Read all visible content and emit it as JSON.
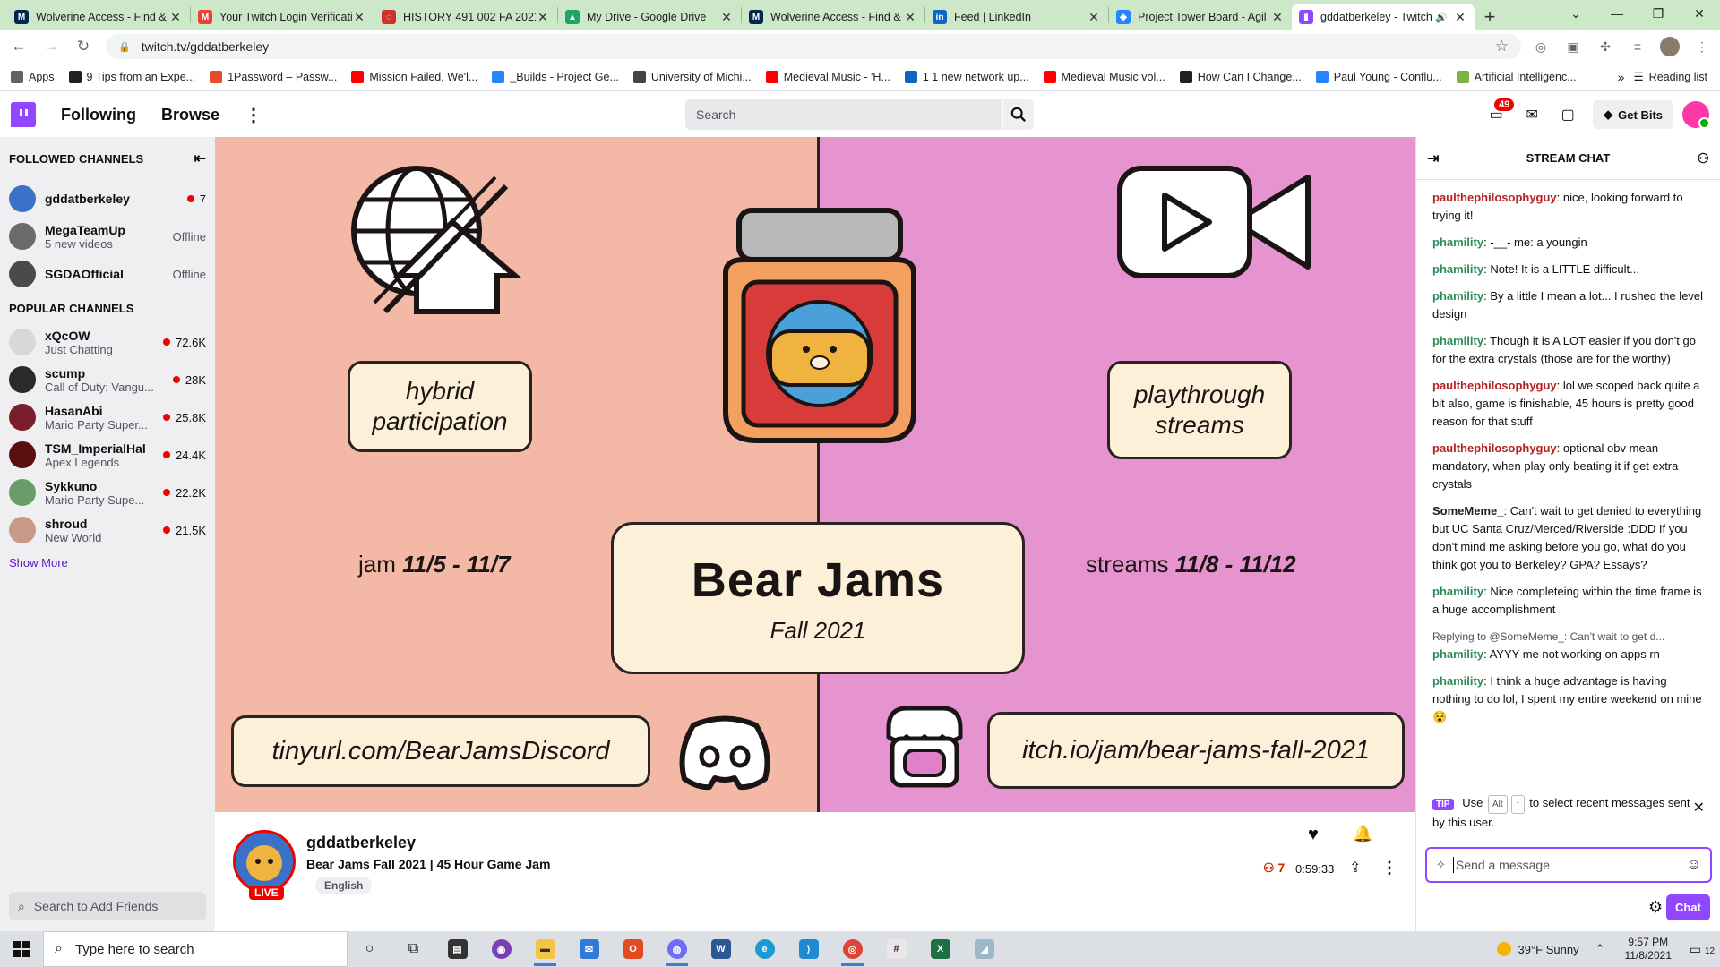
{
  "browser": {
    "tabs": [
      {
        "label": "Wolverine Access - Find &",
        "fav_color": "#00274c",
        "fav_glyph": "M"
      },
      {
        "label": "Your Twitch Login Verificati",
        "fav_color": "#ea4335",
        "fav_glyph": "M"
      },
      {
        "label": "HISTORY 491 002 FA 2021",
        "fav_color": "#d0312d",
        "fav_glyph": "◌"
      },
      {
        "label": "My Drive - Google Drive",
        "fav_color": "#1fa463",
        "fav_glyph": "▲"
      },
      {
        "label": "Wolverine Access - Find &",
        "fav_color": "#00274c",
        "fav_glyph": "M"
      },
      {
        "label": "Feed | LinkedIn",
        "fav_color": "#0a66c2",
        "fav_glyph": "in"
      },
      {
        "label": "Project Tower Board - Agil",
        "fav_color": "#2684ff",
        "fav_glyph": "◆"
      },
      {
        "label": "gddatberkeley - Twitch",
        "fav_color": "#9147ff",
        "fav_glyph": "▮",
        "active": true
      }
    ],
    "address": "twitch.tv/gddatberkeley",
    "bookmarks": [
      {
        "label": "Apps",
        "color": "#5f6368"
      },
      {
        "label": "9 Tips from an Expe...",
        "color": "#202124"
      },
      {
        "label": "1Password – Passw...",
        "color": "#e34b2b"
      },
      {
        "label": "Mission Failed, We'l...",
        "color": "#ff0000"
      },
      {
        "label": "_Builds - Project Ge...",
        "color": "#2684ff"
      },
      {
        "label": "University of Michi...",
        "color": "#444444"
      },
      {
        "label": "Medieval Music - 'H...",
        "color": "#ff0000"
      },
      {
        "label": "1 1 new network up...",
        "color": "#0a66c2"
      },
      {
        "label": "Medieval Music vol...",
        "color": "#ff0000"
      },
      {
        "label": "How Can I Change...",
        "color": "#202124"
      },
      {
        "label": "Paul Young - Conflu...",
        "color": "#2684ff"
      },
      {
        "label": "Artificial Intelligenc...",
        "color": "#7cb342"
      }
    ],
    "reading_list": "Reading list"
  },
  "topnav": {
    "following": "Following",
    "browse": "Browse",
    "search_placeholder": "Search",
    "notification_count": "49",
    "get_bits": "Get Bits"
  },
  "sidebar": {
    "followed_heading": "Followed Channels",
    "followed": [
      {
        "name": "gddatberkeley",
        "sub": "",
        "status": "7",
        "live": true,
        "color": "#3a72c8"
      },
      {
        "name": "MegaTeamUp",
        "sub": "5 new videos",
        "status": "Offline",
        "live": false,
        "color": "#6b6b6b"
      },
      {
        "name": "SGDAOfficial",
        "sub": "",
        "status": "Offline",
        "live": false,
        "color": "#4a4a4a"
      }
    ],
    "popular_heading": "Popular Channels",
    "popular": [
      {
        "name": "xQcOW",
        "sub": "Just Chatting",
        "status": "72.6K",
        "live": true,
        "color": "#d8d8d8"
      },
      {
        "name": "scump",
        "sub": "Call of Duty: Vangu...",
        "status": "28K",
        "live": true,
        "color": "#2a2a2a"
      },
      {
        "name": "HasanAbi",
        "sub": "Mario Party Super...",
        "status": "25.8K",
        "live": true,
        "color": "#7a1e2b"
      },
      {
        "name": "TSM_ImperialHal",
        "sub": "Apex Legends",
        "status": "24.4K",
        "live": true,
        "color": "#5a0e0e"
      },
      {
        "name": "Sykkuno",
        "sub": "Mario Party Supe...",
        "status": "22.2K",
        "live": true,
        "color": "#6a9c6a"
      },
      {
        "name": "shroud",
        "sub": "New World",
        "status": "21.5K",
        "live": true,
        "color": "#c79a8a"
      }
    ],
    "show_more": "Show More",
    "friend_search": "Search to Add Friends"
  },
  "video": {
    "hybrid_line1": "hybrid",
    "hybrid_line2": "participation",
    "playthrough_line1": "playthrough",
    "playthrough_line2": "streams",
    "jam_prefix": "jam ",
    "jam_dates": "11/5 - 11/7",
    "streams_prefix": "streams ",
    "streams_dates": "11/8 - 11/12",
    "title": "Bear Jams",
    "subtitle": "Fall 2021",
    "discord_link": "tinyurl.com/BearJamsDiscord",
    "itch_link": "itch.io/jam/bear-jams-fall-2021",
    "bg_left": "#f3b9a6",
    "bg_right": "#e594cf"
  },
  "stream": {
    "streamer": "gddatberkeley",
    "title": "Bear Jams Fall 2021 | 45 Hour Game Jam",
    "tag": "English",
    "live": "LIVE",
    "viewers": "7",
    "uptime": "0:59:33"
  },
  "chat": {
    "heading": "Stream Chat",
    "messages": [
      {
        "user": "paulthephilosophyguy",
        "text": "nice, looking forward to trying it!",
        "cls": "u-paul"
      },
      {
        "user": "phamility",
        "text": "-__- me: a youngin",
        "cls": "u-pham"
      },
      {
        "user": "phamility",
        "text": "Note! It is a LITTLE difficult...",
        "cls": "u-pham"
      },
      {
        "user": "phamility",
        "text": "By a little I mean a lot... I rushed the level design",
        "cls": "u-pham"
      },
      {
        "user": "phamility",
        "text": "Though it is A LOT easier if you don't go for the extra crystals (those are for the worthy)",
        "cls": "u-pham"
      },
      {
        "user": "paulthephilosophyguy",
        "text": "lol we scoped back quite a bit also, game is finishable, 45 hours is pretty good reason for that stuff",
        "cls": "u-paul"
      },
      {
        "user": "paulthephilosophyguy",
        "text": "optional obv mean mandatory, when play only beating it if get extra crystals",
        "cls": "u-paul"
      },
      {
        "user": "SomeMeme_",
        "text": "Can't wait to get denied to everything but UC Santa Cruz/Merced/Riverside :DDD If you don't mind me asking before you go, what do you think got you to Berkeley? GPA? Essays?",
        "cls": "u-some"
      },
      {
        "user": "phamility",
        "text": "Nice completeing within the time frame is a huge accomplishment",
        "cls": "u-pham"
      },
      {
        "reply": "Replying to @SomeMeme_: Can't wait to get d...",
        "user": "phamility",
        "text": "AYYY me not working on apps rn",
        "cls": "u-pham"
      },
      {
        "user": "phamility",
        "text": "I think a huge advantage is having nothing to do lol, I spent my entire weekend on mine 😵",
        "cls": "u-pham"
      }
    ],
    "tip_label": "TIP",
    "tip_use": "Use",
    "tip_key1": "Alt",
    "tip_key2": "↑",
    "tip_rest": "to select recent messages sent by this user.",
    "input_placeholder": "Send a message",
    "chat_button": "Chat"
  },
  "taskbar": {
    "search_placeholder": "Type here to search",
    "weather": "39°F  Sunny",
    "time": "9:57 PM",
    "date": "11/8/2021",
    "notifications": "12"
  }
}
